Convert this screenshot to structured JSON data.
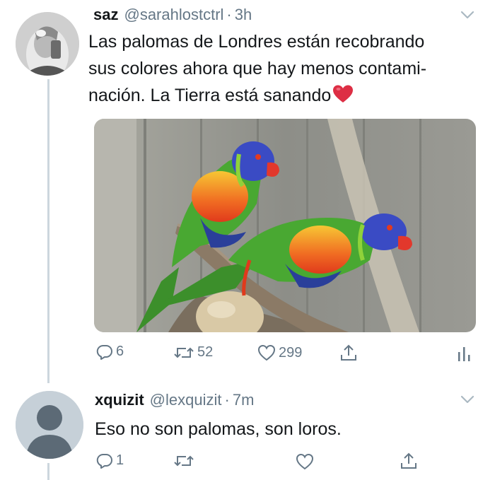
{
  "tweet": {
    "author_name": "saz",
    "handle": "@sarahlostctrl",
    "separator": "·",
    "time": "3h",
    "text": "Las palomas de Londres están recobrando sus colores ahora que hay menos contami-nación. La Tierra está sanando",
    "text_lines": [
      "Las palomas de Londres están recobrando",
      "sus colores ahora que hay menos contami-",
      "nación. La Tierra está sanando"
    ],
    "emoji": "red-heart",
    "media": "photo of two rainbow lorikeets perched on a branch",
    "actions": {
      "replies": "6",
      "retweets": "52",
      "likes": "299"
    }
  },
  "reply": {
    "author_name": "xquizit",
    "handle": "@lexquizit",
    "separator": "·",
    "time": "7m",
    "text": "Eso no son palomas, son loros.",
    "actions": {
      "replies": "1"
    }
  },
  "icons": {
    "reply": "reply-icon",
    "retweet": "retweet-icon",
    "like": "heart-icon",
    "share": "share-icon",
    "analytics": "analytics-icon",
    "caret": "chevron-down-icon"
  },
  "colors": {
    "text": "#14171a",
    "muted": "#657786",
    "thread_line": "#ccd6dd",
    "heart_emoji": "#dd2e44"
  }
}
